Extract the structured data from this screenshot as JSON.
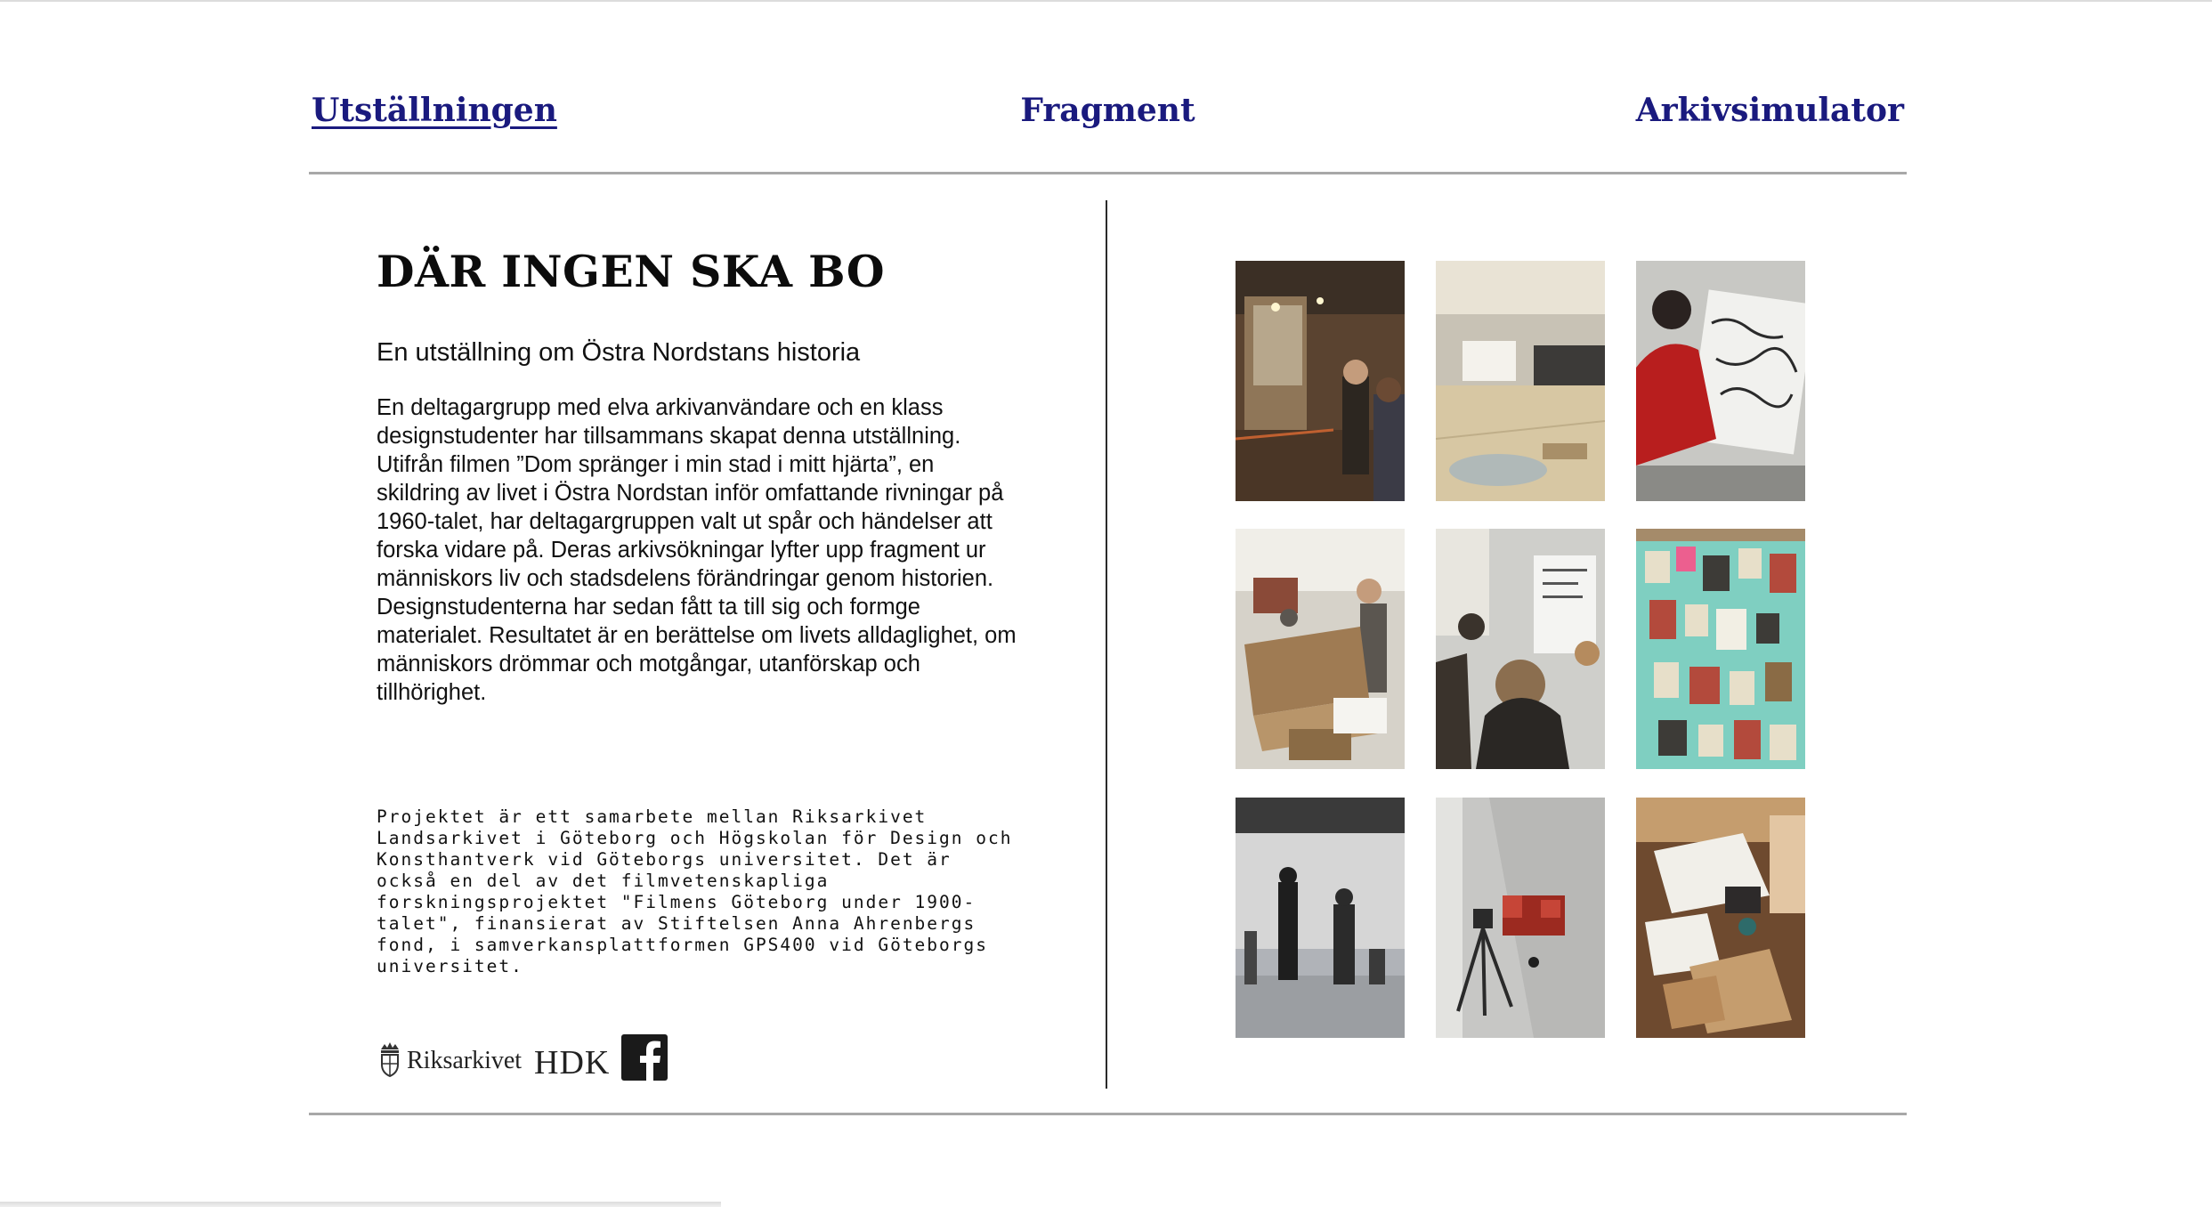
{
  "nav": {
    "items": [
      {
        "label": "Utställningen",
        "active": true
      },
      {
        "label": "Fragment",
        "active": false
      },
      {
        "label": "Arkivsimulator",
        "active": false
      }
    ]
  },
  "main": {
    "title": "DÄR INGEN SKA BO",
    "subtitle": "En utställning om Östra Nordstans historia",
    "body": "En deltagargrupp med elva arkivanvändare och en klass designstudenter har tillsammans skapat denna utställning. Utifrån filmen ”Dom spränger i min stad i mitt hjärta”, en skildring av livet i Östra Nordstan inför omfattande rivningar på 1960-talet, har deltagargruppen valt ut spår och händelser att forska vidare på. Deras arkivsökningar lyfter upp fragment ur människors liv och stadsdelens förändringar genom historien. Designstudenterna har sedan fått ta till sig och formge materialet. Resultatet är en berättelse om livets alldaglighet, om människors drömmar och motgångar, utanförskap och tillhörighet.",
    "credits": "Projektet är ett samarbete mellan Riksarkivet Landsarkivet i Göteborg och Högskolan för Design och Konsthantverk vid Göteborgs universitet. Det är också en del av det filmvetenskapliga forskningsprojektet \"Filmens Göteborg under 1900-talet\", finansierat av Stiftelsen Anna Ahrenbergs fond, i samverkansplattformen GPS400 vid Göteborgs universitet."
  },
  "logos": {
    "riksarkivet": "Riksarkivet",
    "hdk": "HDK",
    "facebook_icon": "facebook-icon"
  },
  "gallery": {
    "photos": [
      {
        "name": "photo-industrial-hall",
        "colors": [
          "#5a4330",
          "#8f7658",
          "#d9cfb8",
          "#2c2620"
        ]
      },
      {
        "name": "photo-exhibition-room",
        "colors": [
          "#b8a98d",
          "#d7c7a3",
          "#3c3a38",
          "#e9e3d5"
        ]
      },
      {
        "name": "photo-drawing-person",
        "colors": [
          "#c8c8c4",
          "#b81e1e",
          "#f1f1ee",
          "#2a2a2a"
        ]
      },
      {
        "name": "photo-cardboard-workshop",
        "colors": [
          "#d6d2c9",
          "#9f7b53",
          "#5b5650",
          "#f0eee8"
        ]
      },
      {
        "name": "photo-students-whiteboard",
        "colors": [
          "#cfcfcb",
          "#3a332c",
          "#e8e6df",
          "#8b6e4f"
        ]
      },
      {
        "name": "photo-moodboard-wall",
        "colors": [
          "#7fcfc1",
          "#b34a3c",
          "#e7dfc9",
          "#3d3b37"
        ]
      },
      {
        "name": "photo-gallery-visitors",
        "colors": [
          "#d6d6d6",
          "#8d8f93",
          "#1e1e1e",
          "#b0b3b8"
        ]
      },
      {
        "name": "photo-camera-tripod",
        "colors": [
          "#c7c7c5",
          "#9c2a20",
          "#e3e3e0",
          "#2a2a2a"
        ]
      },
      {
        "name": "photo-model-making",
        "colors": [
          "#c59d6e",
          "#f1efe9",
          "#6e4a2f",
          "#2d2a2a"
        ]
      }
    ]
  }
}
